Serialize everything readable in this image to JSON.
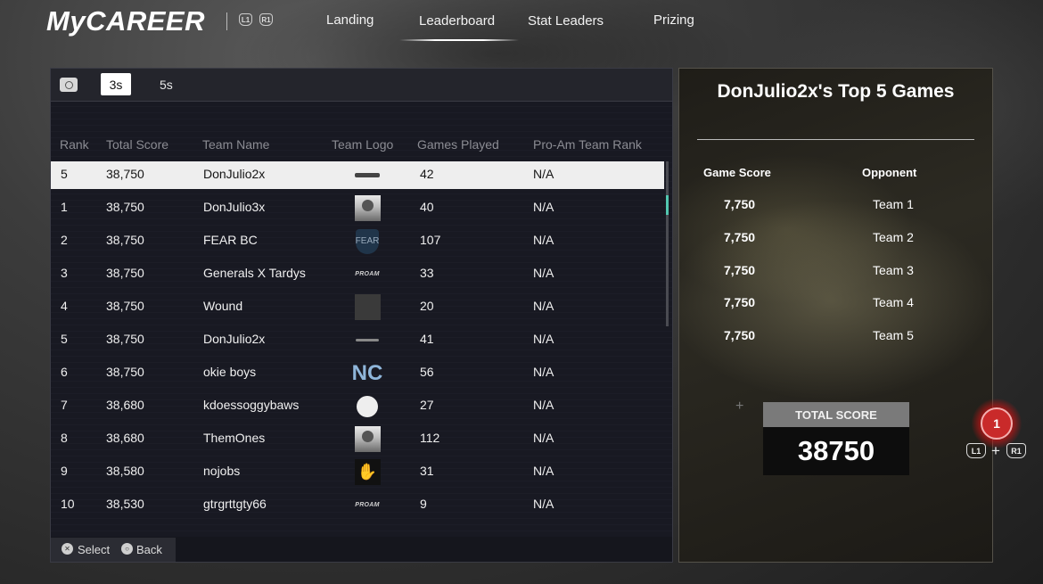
{
  "header": {
    "logo": "MyCAREER",
    "bumper_left": "L1",
    "bumper_right": "R1",
    "tabs": [
      "Landing",
      "Leaderboard",
      "Stat Leaders",
      "Prizing"
    ],
    "active_tab": "Leaderboard"
  },
  "filters": {
    "mode_3s": "3s",
    "mode_5s": "5s",
    "selected": "3s"
  },
  "table": {
    "headers": [
      "Rank",
      "Total Score",
      "Team Name",
      "Team Logo",
      "Games Played",
      "Pro-Am Team Rank"
    ],
    "rows": [
      {
        "rank": "5",
        "score": "38,750",
        "team": "DonJulio2x",
        "logo": "strip-logo",
        "games": "42",
        "proam": "N/A",
        "selected": true
      },
      {
        "rank": "1",
        "score": "38,750",
        "team": "DonJulio3x",
        "logo": "photo-logo",
        "games": "40",
        "proam": "N/A"
      },
      {
        "rank": "2",
        "score": "38,750",
        "team": "FEAR BC",
        "logo": "shield-logo",
        "games": "107",
        "proam": "N/A"
      },
      {
        "rank": "3",
        "score": "38,750",
        "team": "Generals X Tardys",
        "logo": "proam-logo",
        "games": "33",
        "proam": "N/A"
      },
      {
        "rank": "4",
        "score": "38,750",
        "team": "Wound",
        "logo": "dark-square-logo",
        "games": "20",
        "proam": "N/A"
      },
      {
        "rank": "5",
        "score": "38,750",
        "team": "DonJulio2x",
        "logo": "thin-strip-logo",
        "games": "41",
        "proam": "N/A"
      },
      {
        "rank": "6",
        "score": "38,750",
        "team": "okie boys",
        "logo": "nc-logo",
        "games": "56",
        "proam": "N/A"
      },
      {
        "rank": "7",
        "score": "38,680",
        "team": "kdoessoggybaws",
        "logo": "blob-logo",
        "games": "27",
        "proam": "N/A"
      },
      {
        "rank": "8",
        "score": "38,680",
        "team": "ThemOnes",
        "logo": "photo-logo",
        "games": "112",
        "proam": "N/A"
      },
      {
        "rank": "9",
        "score": "38,580",
        "team": "nojobs",
        "logo": "hand-logo",
        "games": "31",
        "proam": "N/A"
      },
      {
        "rank": "10",
        "score": "38,530",
        "team": "gtrgrttgty66",
        "logo": "proam-logo",
        "games": "9",
        "proam": "N/A"
      }
    ],
    "logo_texts": {
      "shield": "FEAR",
      "proam": "PROAM",
      "nc": "NC"
    }
  },
  "footer": {
    "select_label": "Select",
    "back_label": "Back"
  },
  "top5": {
    "title": "DonJulio2x's Top 5 Games",
    "col_score": "Game Score",
    "col_opponent": "Opponent",
    "games": [
      {
        "score": "7,750",
        "opponent": "Team 1"
      },
      {
        "score": "7,750",
        "opponent": "Team 2"
      },
      {
        "score": "7,750",
        "opponent": "Team 3"
      },
      {
        "score": "7,750",
        "opponent": "Team 4"
      },
      {
        "score": "7,750",
        "opponent": "Team 5"
      }
    ],
    "total_label": "TOTAL SCORE",
    "total_value": "38750"
  },
  "corner": {
    "badge_count": "1",
    "combo_left": "L1",
    "combo_plus": "+",
    "combo_right": "R1"
  },
  "colors": {
    "selected_row": "#eeeeee",
    "scroll_thumb": "#52c7b0",
    "badge": "#c92a2a"
  }
}
